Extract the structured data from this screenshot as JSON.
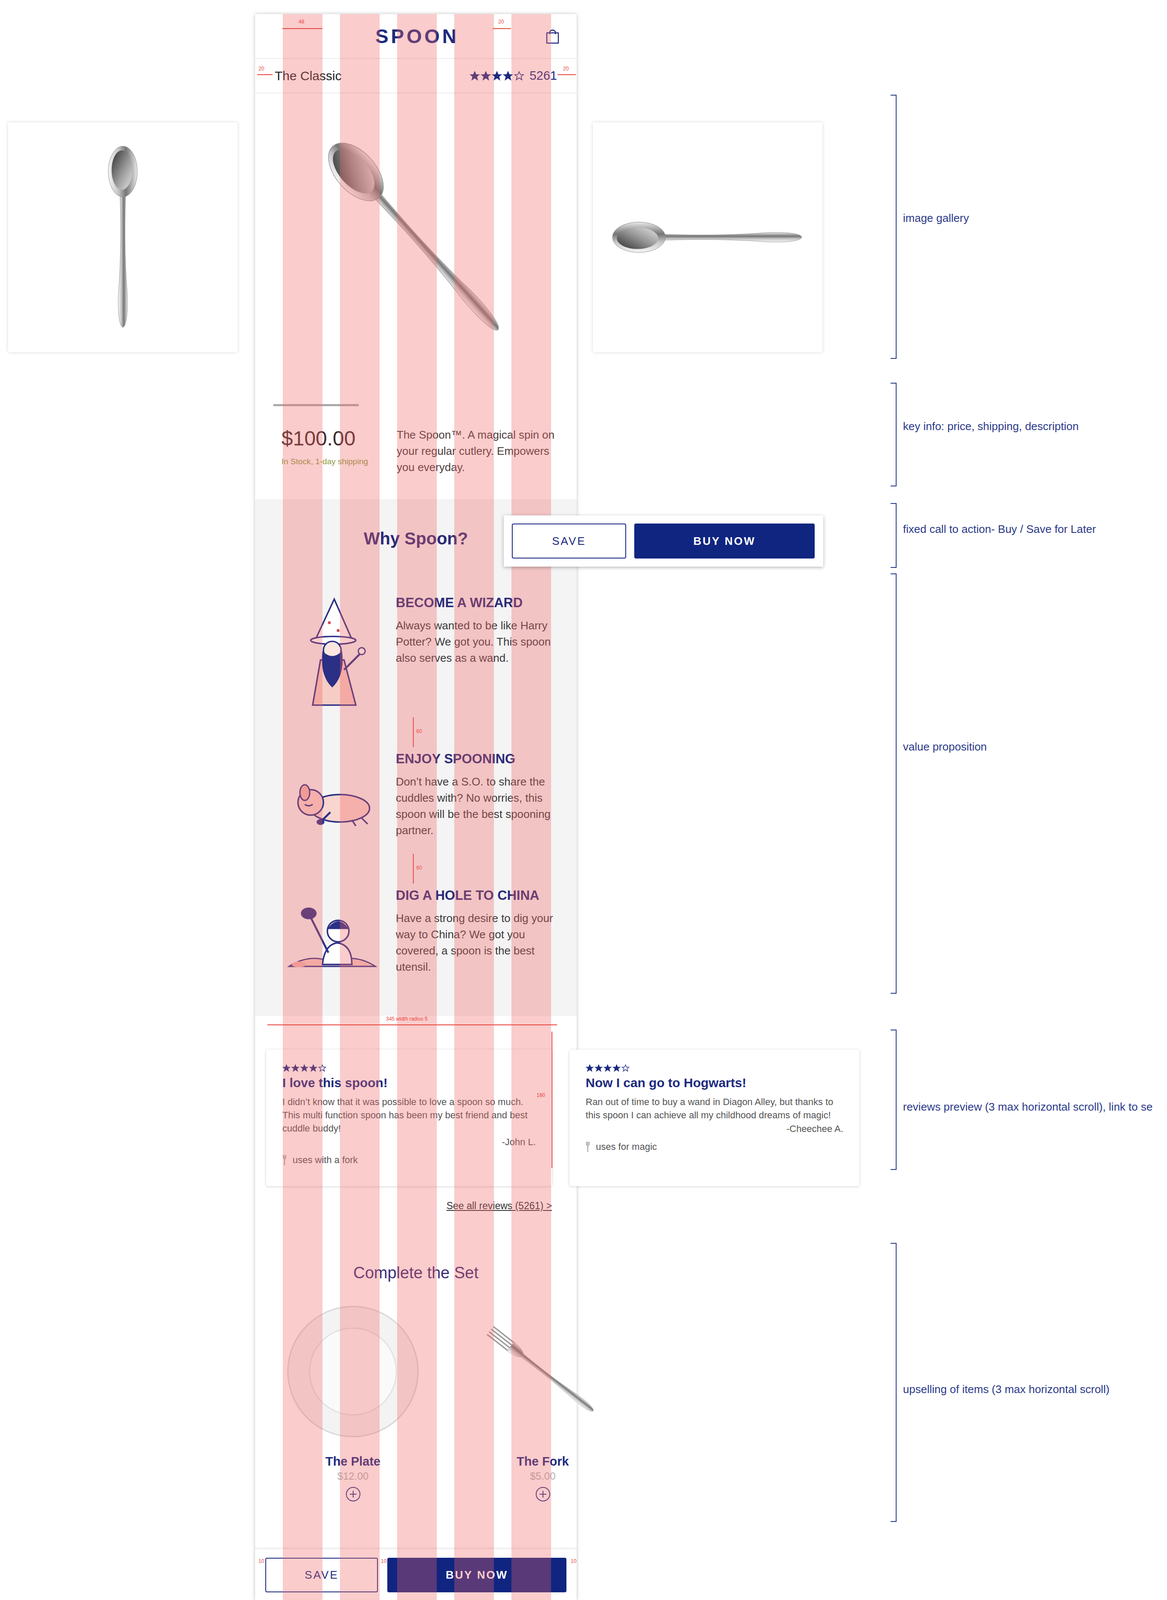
{
  "header": {
    "logo": "SPOON"
  },
  "product": {
    "name": "The Classic",
    "stars": 4,
    "rating_count": "5261",
    "price": "$100.00",
    "availability": "In Stock, 1-day shipping",
    "description": "The Spoon™. A magical spin on your regular cutlery. Empowers you everyday."
  },
  "gallery": {
    "level": 0.3
  },
  "value_prop": {
    "title": "Why Spoon?",
    "features": [
      {
        "kind": "wizard",
        "title": "BECOME A WIZARD",
        "text": "Always wanted to be like Harry Potter? We got you. This spoon also serves as a wand."
      },
      {
        "kind": "dog",
        "title": "ENJOY SPOONING",
        "text": "Don’t have a S.O. to share the cuddles with? No worries, this spoon will be the best spooning partner."
      },
      {
        "kind": "digger",
        "title": "DIG A HOLE TO CHINA",
        "text": "Have a strong desire to dig your way to China? We got you covered, a spoon is the best utensil."
      }
    ]
  },
  "reviews": {
    "items": [
      {
        "stars": 4,
        "title": "I love this spoon!",
        "text": "I didn’t know that it was possible to love a spoon so much. This multi function spoon has been my best friend and best cuddle buddy!",
        "author": "-John L.",
        "use": "uses with a fork"
      },
      {
        "stars": 4,
        "title": "Now I can go to Hogwarts!",
        "text": "Ran out of time to buy a wand in Diagon Alley, but thanks to this spoon I can achieve all my childhood dreams of magic!",
        "author": "-Cheechee A.",
        "use": "uses for magic"
      }
    ],
    "link": "See all reviews (5261) >"
  },
  "upsell": {
    "title": "Complete the Set",
    "items": [
      {
        "kind": "plate",
        "name": "The Plate",
        "price": "$12.00"
      },
      {
        "kind": "fork",
        "name": "The Fork",
        "price": "$5.00"
      }
    ]
  },
  "cta_preview": {
    "save": "SAVE",
    "buy": "BUY NOW"
  },
  "bottom_bar": {
    "save": "SAVE",
    "buy": "BUY NOW"
  },
  "annotations": [
    "image gallery",
    "key info: price, shipping, description",
    "fixed call to action- Buy / Save for Later",
    "value proposition",
    "reviews preview (3 max horizontal scroll), link to se",
    "upselling of items (3 max horizontal scroll)"
  ],
  "measures": [
    "48",
    "20",
    "20",
    "20",
    "60",
    "60",
    "345 width radius 5",
    "160",
    "10",
    "10",
    "10"
  ]
}
